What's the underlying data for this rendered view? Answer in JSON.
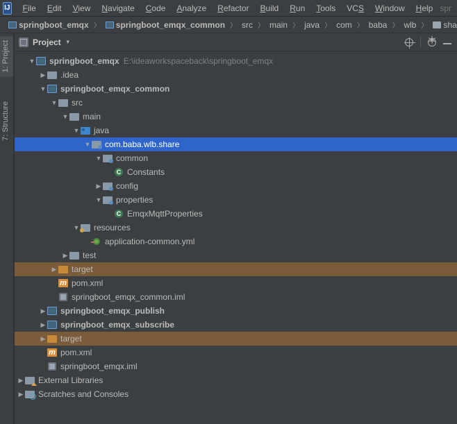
{
  "menu": {
    "items": [
      "File",
      "Edit",
      "View",
      "Navigate",
      "Code",
      "Analyze",
      "Refactor",
      "Build",
      "Run",
      "Tools",
      "VCS",
      "Window",
      "Help"
    ],
    "right_fade": "spr"
  },
  "breadcrumb": {
    "items": [
      {
        "label": "springboot_emqx",
        "bold": true,
        "icon": "mod"
      },
      {
        "label": "springboot_emqx_common",
        "bold": true,
        "icon": "mod"
      },
      {
        "label": "src",
        "bold": false,
        "icon": null
      },
      {
        "label": "main",
        "bold": false,
        "icon": null
      },
      {
        "label": "java",
        "bold": false,
        "icon": null
      },
      {
        "label": "com",
        "bold": false,
        "icon": null
      },
      {
        "label": "baba",
        "bold": false,
        "icon": null
      },
      {
        "label": "wlb",
        "bold": false,
        "icon": null
      },
      {
        "label": "share",
        "bold": false,
        "icon": "dir"
      }
    ]
  },
  "sidetabs": {
    "project": "1: Project",
    "structure": "7: Structure"
  },
  "panel": {
    "title": "Project",
    "root": {
      "label": "springboot_emqx",
      "path": "E:\\ideaworkspaceback\\springboot_emqx"
    },
    "tree": [
      {
        "indent": 0,
        "arrow": "exp",
        "icon": "mod",
        "label": "springboot_emqx",
        "bold": true,
        "selected": false,
        "extra_path": true
      },
      {
        "indent": 1,
        "arrow": "col",
        "icon": "dir",
        "label": ".idea",
        "bold": false,
        "selected": false
      },
      {
        "indent": 1,
        "arrow": "exp",
        "icon": "mod",
        "label": "springboot_emqx_common",
        "bold": true,
        "selected": false
      },
      {
        "indent": 2,
        "arrow": "exp",
        "icon": "dir",
        "label": "src",
        "bold": false,
        "selected": false
      },
      {
        "indent": 3,
        "arrow": "exp",
        "icon": "dir",
        "label": "main",
        "bold": false,
        "selected": false
      },
      {
        "indent": 4,
        "arrow": "exp",
        "icon": "src",
        "label": "java",
        "bold": false,
        "selected": false
      },
      {
        "indent": 5,
        "arrow": "exp",
        "icon": "pkg",
        "label": "com.baba.wlb.share",
        "bold": false,
        "selected": true
      },
      {
        "indent": 6,
        "arrow": "exp",
        "icon": "pkg",
        "label": "common",
        "bold": false,
        "selected": false
      },
      {
        "indent": 7,
        "arrow": "none",
        "icon": "class",
        "label": "Constants",
        "bold": false,
        "selected": false
      },
      {
        "indent": 6,
        "arrow": "col",
        "icon": "pkg",
        "label": "config",
        "bold": false,
        "selected": false
      },
      {
        "indent": 6,
        "arrow": "exp",
        "icon": "pkg",
        "label": "properties",
        "bold": false,
        "selected": false
      },
      {
        "indent": 7,
        "arrow": "none",
        "icon": "class",
        "label": "EmqxMqttProperties",
        "bold": false,
        "selected": false
      },
      {
        "indent": 4,
        "arrow": "exp",
        "icon": "res",
        "label": "resources",
        "bold": false,
        "selected": false
      },
      {
        "indent": 5,
        "arrow": "none",
        "icon": "yml",
        "label": "application-common.yml",
        "bold": false,
        "selected": false
      },
      {
        "indent": 3,
        "arrow": "col",
        "icon": "dir",
        "label": "test",
        "bold": false,
        "selected": false
      },
      {
        "indent": 2,
        "arrow": "col",
        "icon": "dir-orange",
        "label": "target",
        "bold": false,
        "selected": false,
        "orange": true
      },
      {
        "indent": 2,
        "arrow": "none",
        "icon": "m",
        "label": "pom.xml",
        "bold": false,
        "selected": false
      },
      {
        "indent": 2,
        "arrow": "none",
        "icon": "iml",
        "label": "springboot_emqx_common.iml",
        "bold": false,
        "selected": false
      },
      {
        "indent": 1,
        "arrow": "col",
        "icon": "mod",
        "label": "springboot_emqx_publish",
        "bold": true,
        "selected": false
      },
      {
        "indent": 1,
        "arrow": "col",
        "icon": "mod",
        "label": "springboot_emqx_subscribe",
        "bold": true,
        "selected": false
      },
      {
        "indent": 1,
        "arrow": "col",
        "icon": "dir-orange",
        "label": "target",
        "bold": false,
        "selected": false,
        "orange": true
      },
      {
        "indent": 1,
        "arrow": "none",
        "icon": "m",
        "label": "pom.xml",
        "bold": false,
        "selected": false
      },
      {
        "indent": 1,
        "arrow": "none",
        "icon": "iml",
        "label": "springboot_emqx.iml",
        "bold": false,
        "selected": false
      },
      {
        "indent": 0,
        "arrow": "col",
        "icon": "ext",
        "label": "External Libraries",
        "bold": false,
        "selected": false,
        "rootlevel": true
      },
      {
        "indent": 0,
        "arrow": "col",
        "icon": "scratch",
        "label": "Scratches and Consoles",
        "bold": false,
        "selected": false,
        "rootlevel": true
      }
    ]
  }
}
